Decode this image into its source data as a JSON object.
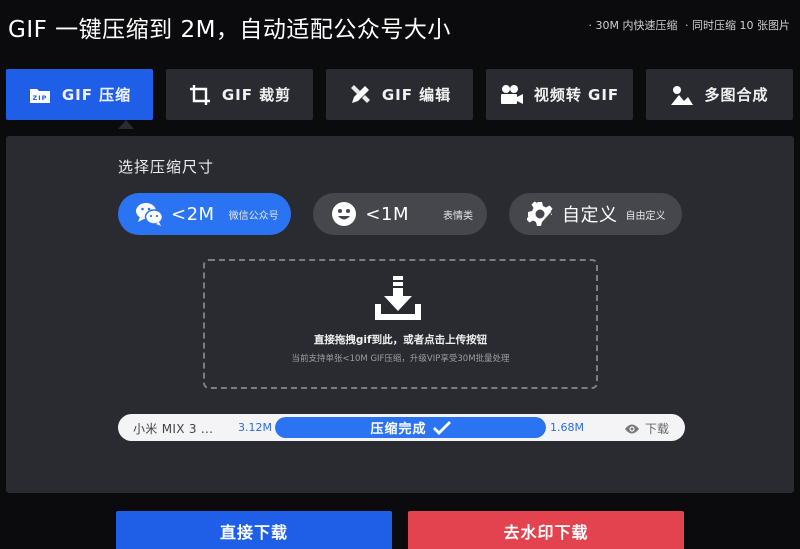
{
  "header": {
    "title": "GIF 一键压缩到 2M，自动适配公众号大小",
    "features": [
      "· 30M 内快速压缩",
      "· 同时压缩 10 张图片"
    ]
  },
  "tabs": [
    {
      "label": "GIF 压缩",
      "icon": "zip-icon",
      "active": true
    },
    {
      "label": "GIF 裁剪",
      "icon": "crop-icon",
      "active": false
    },
    {
      "label": "GIF 编辑",
      "icon": "edit-tools-icon",
      "active": false
    },
    {
      "label": "视频转 GIF",
      "icon": "video-camera-icon",
      "active": false
    },
    {
      "label": "多图合成",
      "icon": "image-icon",
      "active": false
    }
  ],
  "zip_icon_text": "ZIP",
  "compress": {
    "section_title": "选择压缩尺寸",
    "options": [
      {
        "label": "<2M",
        "sub": "微信公众号",
        "icon": "wechat-icon",
        "selected": true
      },
      {
        "label": "<1M",
        "sub": "表情类",
        "icon": "smiley-icon",
        "selected": false
      },
      {
        "label": "自定义",
        "sub": "自由定义",
        "icon": "gear-icon",
        "selected": false
      }
    ]
  },
  "dropzone": {
    "main_text": "直接拖拽gif到此，或者点击上传按钮",
    "sub_text": "当前支持单张<10M GIF压缩，升级VIP享受30M批量处理"
  },
  "file": {
    "name": "小米 MIX 3 ...",
    "size_before": "3.12M",
    "status": "压缩完成",
    "progress": 1.0,
    "size_after": "1.68M",
    "download_label": "下载"
  },
  "buttons": {
    "direct_download": "直接下载",
    "watermark_download": "去水印下载"
  },
  "colors": {
    "accent_blue": "#1f5fe8",
    "option_blue": "#2a73f2",
    "danger_red": "#e2434f",
    "panel": "#2a2b30",
    "background": "#0b0b0d"
  }
}
